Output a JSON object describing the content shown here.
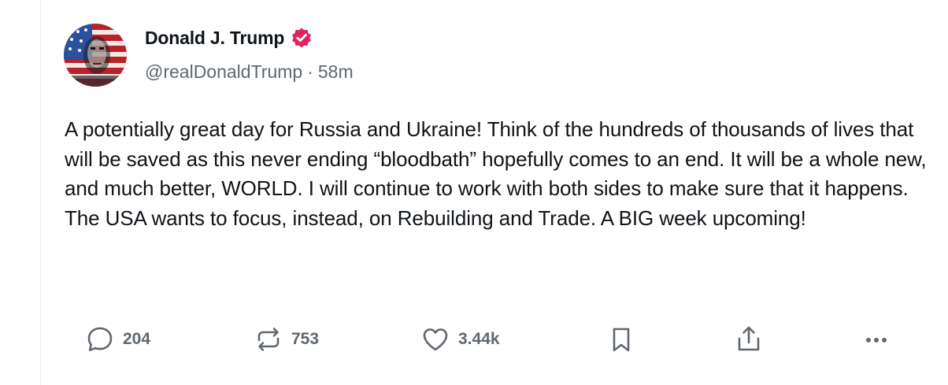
{
  "post": {
    "author": {
      "display_name": "Donald J. Trump",
      "handle": "@realDonaldTrump",
      "separator": "·",
      "time_ago": "58m",
      "verified": true,
      "verified_color": "#e0245e"
    },
    "text": "A potentially great day for Russia and Ukraine! Think of the hundreds of thousands of lives that will be saved as this never ending “bloodbath” hopefully comes to an end. It will be a whole new, and much better, WORLD. I will continue to work with both sides to make sure that it happens. The USA wants to focus, instead, on Rebuilding and Trade. A BIG week upcoming!",
    "actions": {
      "reply": {
        "icon": "comment-icon",
        "count": "204"
      },
      "repost": {
        "icon": "repost-icon",
        "count": "753"
      },
      "like": {
        "icon": "heart-icon",
        "count": "3.44k"
      },
      "bookmark": {
        "icon": "bookmark-icon"
      },
      "share": {
        "icon": "share-icon"
      },
      "more": {
        "icon": "more-icon"
      }
    }
  }
}
